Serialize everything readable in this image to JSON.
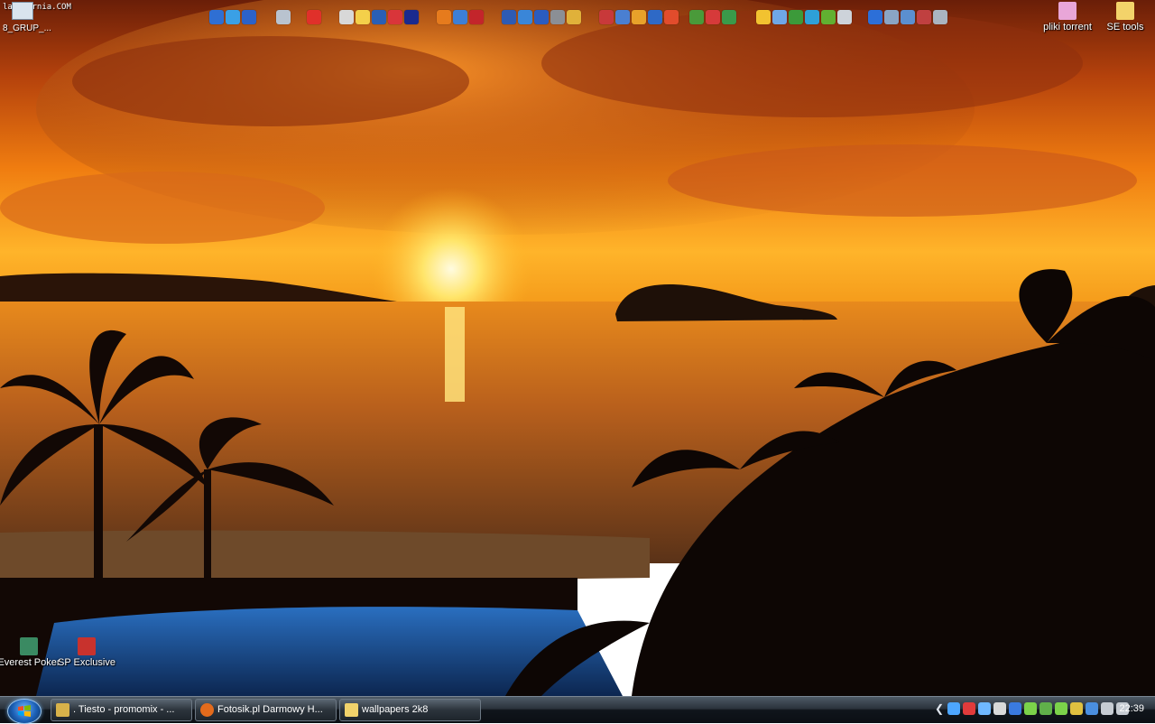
{
  "desktop": {
    "top_left_caption": "lastmarnia.COM",
    "top_left_label": "8_GRUP_...",
    "icons": [
      {
        "label": "pliki torrent",
        "icon": "folder-icon",
        "color": "#e9a6d8"
      },
      {
        "label": "SE tools",
        "icon": "folder-icon",
        "color": "#f3d36a"
      },
      {
        "label": "Everest Poker",
        "icon": "poker-icon",
        "color": "#3a8a62"
      },
      {
        "label": "SP Exclusive",
        "icon": "game-icon",
        "color": "#c8322d"
      }
    ],
    "quick_launch_groups": [
      {
        "icons": [
          "#2f6fd3",
          "#3aa0e6",
          "#2c62c8"
        ]
      },
      {
        "icons": [
          "#b9c3cf"
        ]
      },
      {
        "icons": [
          "#e0302a"
        ]
      },
      {
        "icons": [
          "#d8d8d8",
          "#f4d04a",
          "#2a5fb5",
          "#d9353a",
          "#1a2a8e"
        ]
      },
      {
        "icons": [
          "#e67b1d",
          "#3d7fd6",
          "#c3252b"
        ]
      },
      {
        "icons": [
          "#2e5bb3",
          "#3a86d8",
          "#2b5cc0",
          "#8b8f95",
          "#e0b13a"
        ]
      },
      {
        "icons": [
          "#c8393a",
          "#4a7fd1",
          "#e8a12a",
          "#2e69c6",
          "#e14c2c"
        ]
      },
      {
        "icons": [
          "#4a9a3a",
          "#d63a3a",
          "#3a9a4a"
        ]
      },
      {
        "icons": [
          "#f2c230",
          "#6fa7e6",
          "#3c9a3a",
          "#2ea0d8",
          "#61b031",
          "#cdd3da"
        ]
      },
      {
        "icons": [
          "#2c6fd8",
          "#8aa5c4",
          "#5b8fd0",
          "#c04040",
          "#aab4c0"
        ]
      }
    ]
  },
  "taskbar": {
    "start_label": "Start",
    "buttons": [
      {
        "label": ". Tiesto - promomix - ...",
        "icon": "music-icon",
        "color": "#d8b24a"
      },
      {
        "label": "Fotosik.pl Darmowy H...",
        "icon": "firefox-icon",
        "color": "#e46b1c"
      },
      {
        "label": "wallpapers 2k8",
        "icon": "folder-icon",
        "color": "#f2d36b"
      }
    ],
    "tray_icons": [
      "#4da6ff",
      "#e23b3b",
      "#6fb8ff",
      "#d9d9d9",
      "#3a7ae0",
      "#7bd24a",
      "#60b04a",
      "#7bd24a",
      "#e0c040",
      "#4a8fe0",
      "#c6ccd3",
      "#c6ccd3"
    ],
    "clock": "22:39"
  }
}
